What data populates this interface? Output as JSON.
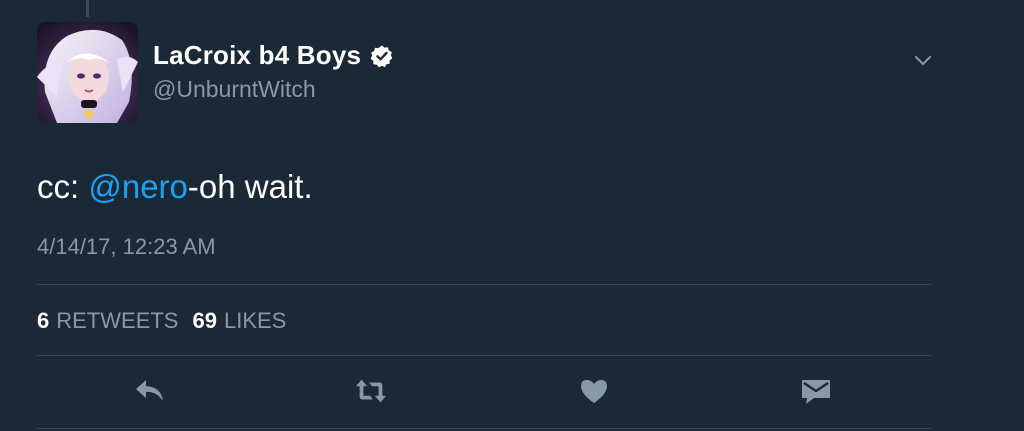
{
  "author": {
    "display_name": "LaCroix b4 Boys",
    "handle": "@UnburntWitch",
    "verified": true,
    "avatar_icon": "avatar-illustration"
  },
  "tweet": {
    "text_prefix": "cc: ",
    "mention": "@nero",
    "text_suffix": "-oh wait.",
    "timestamp": "4/14/17, 12:23 AM"
  },
  "stats": {
    "retweets_count": "6",
    "retweets_label": "RETWEETS",
    "likes_count": "69",
    "likes_label": "LIKES"
  },
  "actions": {
    "reply_icon": "reply-icon",
    "retweet_icon": "retweet-icon",
    "like_icon": "heart-icon",
    "dm_icon": "envelope-icon"
  },
  "colors": {
    "background": "#1b2836",
    "text_primary": "#ffffff",
    "text_secondary": "#8899a6",
    "mention": "#1da1f2",
    "divider": "#38444d"
  }
}
